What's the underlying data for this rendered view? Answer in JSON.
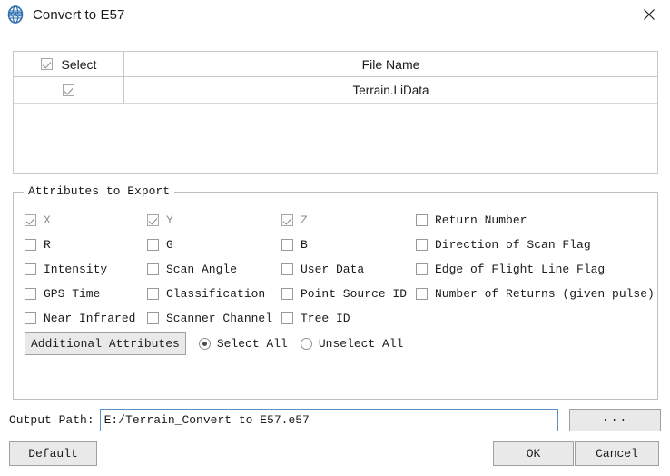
{
  "window": {
    "title": "Convert to E57",
    "icon": "app-globe-icon",
    "close_label": "✕"
  },
  "file_table": {
    "columns": [
      "Select",
      "File Name"
    ],
    "header_checkbox_checked": true,
    "rows": [
      {
        "selected": true,
        "file_name": "Terrain.LiData"
      }
    ]
  },
  "attributes_group": {
    "legend": "Attributes to Export",
    "items": [
      {
        "label": "X",
        "checked": true,
        "disabled": true
      },
      {
        "label": "Y",
        "checked": true,
        "disabled": true
      },
      {
        "label": "Z",
        "checked": true,
        "disabled": true
      },
      {
        "label": "Return Number",
        "checked": false,
        "disabled": false
      },
      {
        "label": "R",
        "checked": false,
        "disabled": false
      },
      {
        "label": "G",
        "checked": false,
        "disabled": false
      },
      {
        "label": "B",
        "checked": false,
        "disabled": false
      },
      {
        "label": "Direction of Scan Flag",
        "checked": false,
        "disabled": false
      },
      {
        "label": "Intensity",
        "checked": false,
        "disabled": false
      },
      {
        "label": "Scan Angle",
        "checked": false,
        "disabled": false
      },
      {
        "label": "User Data",
        "checked": false,
        "disabled": false
      },
      {
        "label": "Edge of Flight Line Flag",
        "checked": false,
        "disabled": false
      },
      {
        "label": "GPS Time",
        "checked": false,
        "disabled": false
      },
      {
        "label": "Classification",
        "checked": false,
        "disabled": false
      },
      {
        "label": "Point Source ID",
        "checked": false,
        "disabled": false
      },
      {
        "label": "Number of Returns (given pulse)",
        "checked": false,
        "disabled": false
      },
      {
        "label": "Near Infrared",
        "checked": false,
        "disabled": false
      },
      {
        "label": "Scanner Channel",
        "checked": false,
        "disabled": false
      },
      {
        "label": "Tree ID",
        "checked": false,
        "disabled": false
      },
      {
        "label": "",
        "checked": false,
        "disabled": false
      }
    ],
    "additional_attributes_label": "Additional Attributes",
    "select_all_label": "Select All",
    "unselect_all_label": "Unselect All",
    "selection_mode": "Select All"
  },
  "output": {
    "label": "Output Path:",
    "value": "E:/Terrain_Convert to E57.e57",
    "placeholder": "",
    "browse_label": "..."
  },
  "buttons": {
    "default_label": "Default",
    "ok_label": "OK",
    "cancel_label": "Cancel"
  },
  "colors": {
    "accent_border": "#5a8fc4",
    "button_face": "#e9e9e9",
    "frame": "#c8c8c8"
  }
}
